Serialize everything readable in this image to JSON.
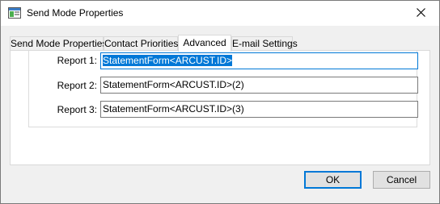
{
  "window": {
    "title": "Send Mode Properties"
  },
  "tabs": [
    {
      "label": "Send Mode Properties",
      "active": false
    },
    {
      "label": "Contact Priorities",
      "active": false
    },
    {
      "label": "Advanced",
      "active": true
    },
    {
      "label": "E-mail Settings",
      "active": false
    }
  ],
  "reports": [
    {
      "label": "Report 1:",
      "value": "StatementForm<ARCUST.ID>"
    },
    {
      "label": "Report 2:",
      "value": "StatementForm<ARCUST.ID>(2)"
    },
    {
      "label": "Report 3:",
      "value": "StatementForm<ARCUST.ID>(3)"
    }
  ],
  "buttons": {
    "ok_label": "OK",
    "cancel_label": "Cancel"
  },
  "icons": {
    "app": "app-window-icon",
    "close": "close-icon"
  },
  "colors": {
    "accent": "#0078d7",
    "selection_text": "#ffffff"
  }
}
